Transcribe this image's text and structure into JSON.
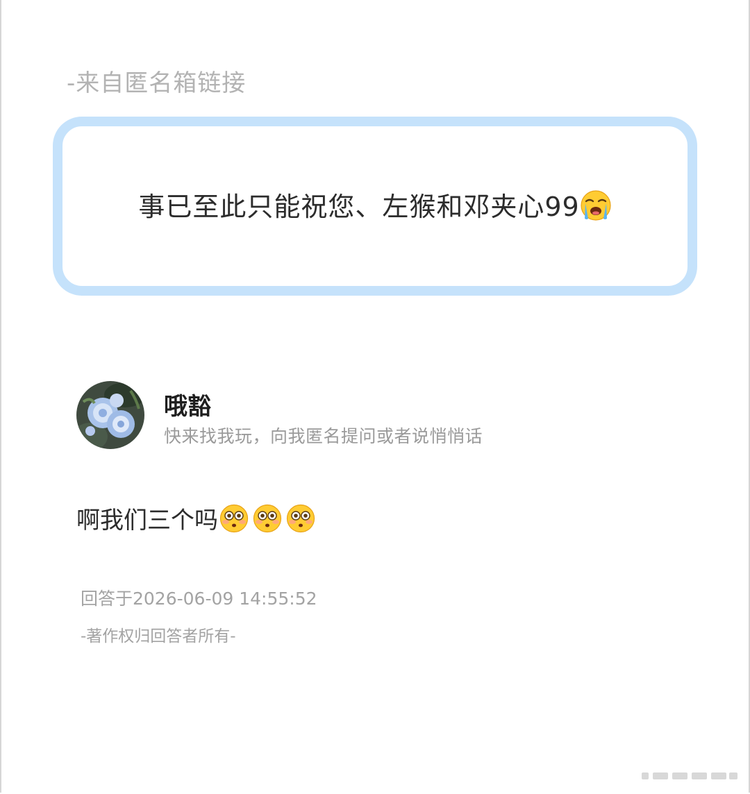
{
  "source_label": "-来自匿名箱链接",
  "question": {
    "text": "事已至此只能祝您、左猴和邓夹心99",
    "emoji": "loudly-crying-face"
  },
  "author": {
    "name": "哦豁",
    "bio": "快来找我玩，向我匿名提问或者说悄悄话",
    "avatar": "blue-roses-avatar"
  },
  "answer": {
    "text": "啊我们三个吗",
    "emojis": [
      "flushed-face",
      "flushed-face",
      "flushed-face"
    ]
  },
  "answered_at": "回答于2026-06-09 14:55:52",
  "copyright": "-著作权归回答者所有-",
  "colors": {
    "card_border": "#c5e2fb",
    "muted_text": "#a3a3a3",
    "body_text": "#2c2c2c"
  }
}
